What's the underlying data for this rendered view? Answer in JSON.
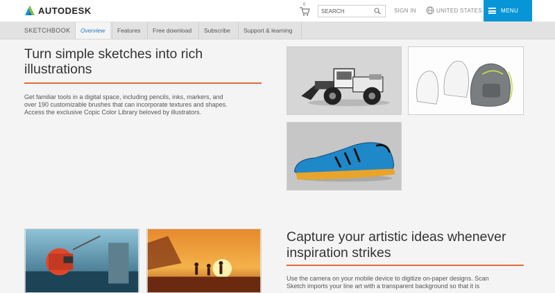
{
  "header": {
    "logo_text": "AUTODESK",
    "cart_count": "0",
    "search_placeholder": "SEARCH",
    "signin_label": "SIGN IN",
    "region_label": "UNITED STATES",
    "menu_label": "MENU"
  },
  "subnav": {
    "title": "SKETCHBOOK",
    "items": [
      {
        "label": "Overview"
      },
      {
        "label": "Features"
      },
      {
        "label": "Free download"
      },
      {
        "label": "Subscribe"
      },
      {
        "label": "Support & learning"
      }
    ]
  },
  "section1": {
    "heading": "Turn simple sketches into rich illustrations",
    "body_lines": [
      "Get familiar tools in a digital space, including pencils, inks, markers, and",
      "over 190 customizable brushes that can incorporate textures and shapes.",
      "Access the exclusive Copic Color Library beloved by illustrators."
    ]
  },
  "section2": {
    "heading_lines": [
      "Capture your artistic ideas whenever",
      "inspiration strikes"
    ],
    "body_lines": [
      "Use the camera on your mobile device to digitize on-paper designs. Scan",
      "Sketch imports your line art with a transparent background so that it is"
    ]
  },
  "colors": {
    "accent_orange": "#e06b3a",
    "menu_blue": "#0696d7",
    "active_link": "#1d7cc0"
  }
}
